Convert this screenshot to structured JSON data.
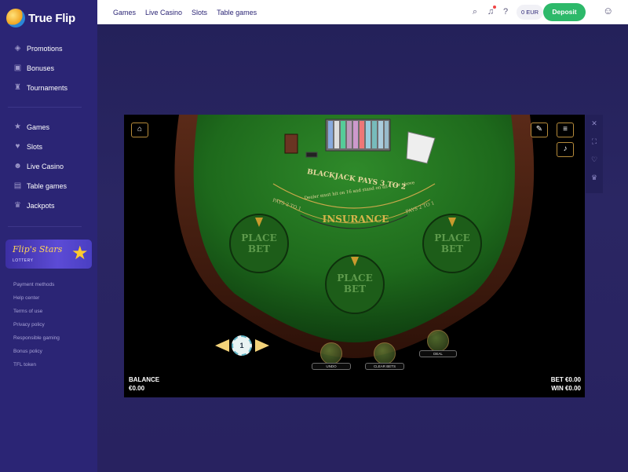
{
  "brand": {
    "name": "True Flip"
  },
  "sidebar": {
    "main_items": [
      {
        "label": "Promotions",
        "icon": "megaphone-icon"
      },
      {
        "label": "Bonuses",
        "icon": "gift-icon"
      },
      {
        "label": "Tournaments",
        "icon": "trophy-icon"
      }
    ],
    "game_items": [
      {
        "label": "Games",
        "icon": "star-icon"
      },
      {
        "label": "Slots",
        "icon": "heart-icon"
      },
      {
        "label": "Live Casino",
        "icon": "person-icon"
      },
      {
        "label": "Table games",
        "icon": "cards-icon"
      },
      {
        "label": "Jackpots",
        "icon": "crown-icon"
      }
    ],
    "lottery": {
      "title": "Flip's Stars",
      "subtitle": "LOTTERY"
    },
    "footer_links": [
      "Payment methods",
      "Help center",
      "Terms of use",
      "Privacy policy",
      "Responsible gaming",
      "Bonus policy",
      "TFL token"
    ]
  },
  "topbar": {
    "nav": [
      "Games",
      "Live Casino",
      "Slots",
      "Table games"
    ],
    "balance": "0 EUR",
    "deposit_label": "Deposit",
    "colors": {
      "deposit": "#2db96a",
      "sidebar": "#2b2575"
    }
  },
  "game": {
    "table_rule_1": "BLACKJACK PAYS 3 TO 2",
    "table_rule_2": "Dealer must hit on 16 and stand on all 17 or above",
    "pays_left": "PAYS 2 TO 1",
    "pays_right": "PAYS 2 TO 1",
    "insurance": "INSURANCE",
    "place_bet": "PLACE BET",
    "chip_value": "1",
    "undo_label": "UNDO",
    "clear_label": "CLEAR BETS",
    "deal_label": "DEAL",
    "balance_label": "BALANCE",
    "balance_value": "€0.00",
    "bet_text": "BET €0.00",
    "win_text": "WIN €0.00"
  }
}
